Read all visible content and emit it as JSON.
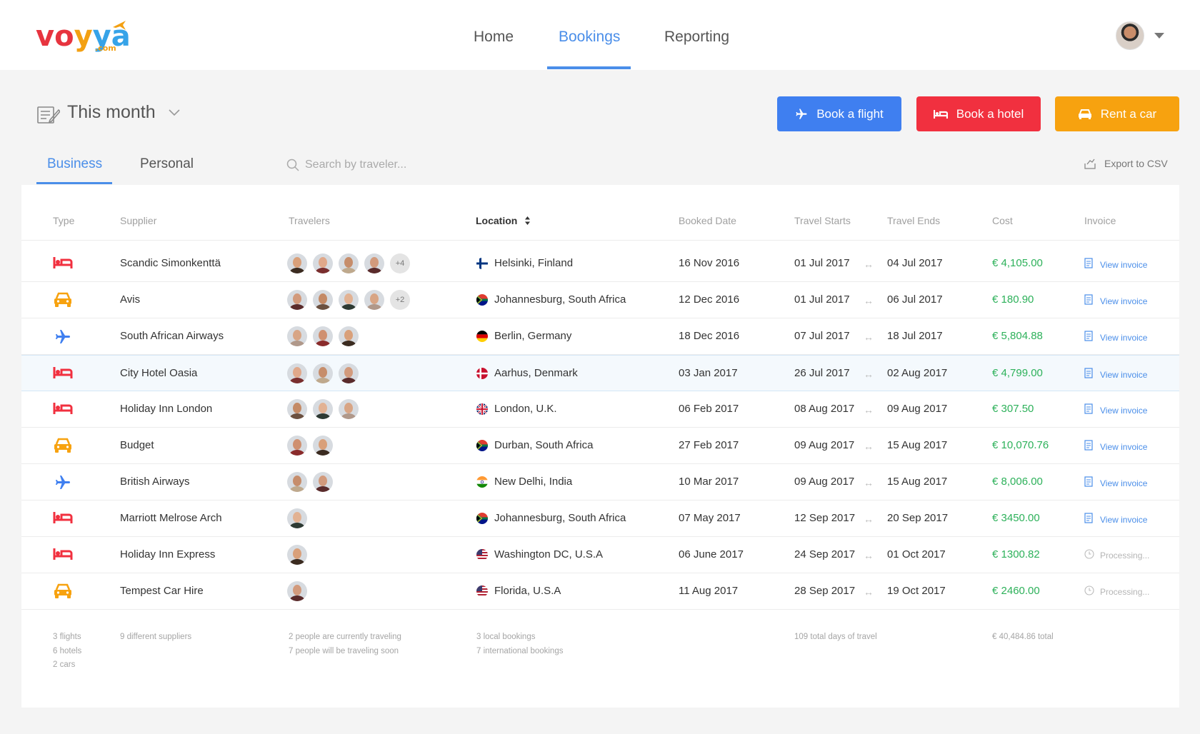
{
  "header": {
    "logo": {
      "l1": "vo",
      "l2": "y",
      "l3": "ya",
      "com": ".com"
    },
    "nav": [
      {
        "label": "Home",
        "active": false
      },
      {
        "label": "Bookings",
        "active": true
      },
      {
        "label": "Reporting",
        "active": false
      }
    ],
    "user_menu_icon": "chevron-down-icon"
  },
  "toolbar": {
    "period_label": "This month",
    "book_flight": "Book a flight",
    "book_hotel": "Book a hotel",
    "rent_car": "Rent a car",
    "colors": {
      "flight": "#3f7ff0",
      "hotel": "#f1303f",
      "car": "#f7a20f",
      "accent": "#4a8ee9",
      "cost": "#2db15a"
    }
  },
  "tabs": [
    {
      "label": "Business",
      "active": true
    },
    {
      "label": "Personal",
      "active": false
    }
  ],
  "search": {
    "placeholder": "Search by traveler..."
  },
  "export_label": "Export to CSV",
  "table": {
    "columns": [
      "Type",
      "Supplier",
      "Travelers",
      "Location",
      "Booked Date",
      "Travel Starts",
      "Travel Ends",
      "Cost",
      "Invoice"
    ],
    "sorted_column": "Location",
    "rows": [
      {
        "type": "hotel",
        "supplier": "Scandic Simonkenttä",
        "travelers": 4,
        "more": "+4",
        "flag": "fi",
        "location": "Helsinki, Finland",
        "booked": "16 Nov 2016",
        "starts": "01 Jul 2017",
        "ends": "04 Jul 2017",
        "cost": "€ 4,105.00",
        "invoice": "View invoice",
        "status": "ready"
      },
      {
        "type": "car",
        "supplier": "Avis",
        "travelers": 4,
        "more": "+2",
        "flag": "za",
        "location": "Johannesburg, South Africa",
        "booked": "12 Dec 2016",
        "starts": "01 Jul 2017",
        "ends": "06 Jul 2017",
        "cost": "€ 180.90",
        "invoice": "View invoice",
        "status": "ready"
      },
      {
        "type": "flight",
        "supplier": "South African Airways",
        "travelers": 3,
        "more": "",
        "flag": "de",
        "location": "Berlin, Germany",
        "booked": "18 Dec 2016",
        "starts": "07 Jul 2017",
        "ends": "18 Jul 2017",
        "cost": "€ 5,804.88",
        "invoice": "View invoice",
        "status": "ready"
      },
      {
        "type": "hotel",
        "supplier": "City Hotel Oasia",
        "travelers": 3,
        "more": "",
        "flag": "dk",
        "location": "Aarhus, Denmark",
        "booked": "03 Jan 2017",
        "starts": "26 Jul 2017",
        "ends": "02 Aug 2017",
        "cost": "€ 4,799.00",
        "invoice": "View invoice",
        "status": "ready",
        "highlight": true
      },
      {
        "type": "hotel",
        "supplier": "Holiday Inn London",
        "travelers": 3,
        "more": "",
        "flag": "uk",
        "location": "London, U.K.",
        "booked": "06 Feb 2017",
        "starts": "08 Aug 2017",
        "ends": "09 Aug 2017",
        "cost": "€ 307.50",
        "invoice": "View invoice",
        "status": "ready"
      },
      {
        "type": "car",
        "supplier": "Budget",
        "travelers": 2,
        "more": "",
        "flag": "za",
        "location": "Durban, South Africa",
        "booked": "27 Feb 2017",
        "starts": "09 Aug 2017",
        "ends": "15 Aug 2017",
        "cost": "€ 10,070.76",
        "invoice": "View invoice",
        "status": "ready"
      },
      {
        "type": "flight",
        "supplier": "British Airways",
        "travelers": 2,
        "more": "",
        "flag": "in",
        "location": "New Delhi, India",
        "booked": "10 Mar 2017",
        "starts": "09 Aug 2017",
        "ends": "15 Aug 2017",
        "cost": "€ 8,006.00",
        "invoice": "View invoice",
        "status": "ready"
      },
      {
        "type": "hotel",
        "supplier": "Marriott Melrose Arch",
        "travelers": 1,
        "more": "",
        "flag": "za",
        "location": "Johannesburg, South Africa",
        "booked": "07 May 2017",
        "starts": "12 Sep 2017",
        "ends": "20 Sep 2017",
        "cost": "€ 3450.00",
        "invoice": "View invoice",
        "status": "ready"
      },
      {
        "type": "hotel",
        "supplier": "Holiday Inn Express",
        "travelers": 1,
        "more": "",
        "flag": "us",
        "location": "Washington DC, U.S.A",
        "booked": "06 June 2017",
        "starts": "24 Sep 2017",
        "ends": "01 Oct 2017",
        "cost": "€ 1300.82",
        "invoice": "Processing...",
        "status": "processing"
      },
      {
        "type": "car",
        "supplier": "Tempest Car Hire",
        "travelers": 1,
        "more": "",
        "flag": "us",
        "location": "Florida, U.S.A",
        "booked": "11 Aug 2017",
        "starts": "28 Sep 2017",
        "ends": "19 Oct 2017",
        "cost": "€ 2460.00",
        "invoice": "Processing...",
        "status": "processing"
      }
    ]
  },
  "summary": {
    "types": [
      "3 flights",
      "6 hotels",
      "2 cars"
    ],
    "suppliers": "9 different suppliers",
    "travelers": [
      "2 people are currently traveling",
      "7 people will be traveling soon"
    ],
    "locations": [
      "3 local bookings",
      "7 international bookings"
    ],
    "days": "109 total days of travel",
    "total": "€ 40,484.86 total"
  }
}
